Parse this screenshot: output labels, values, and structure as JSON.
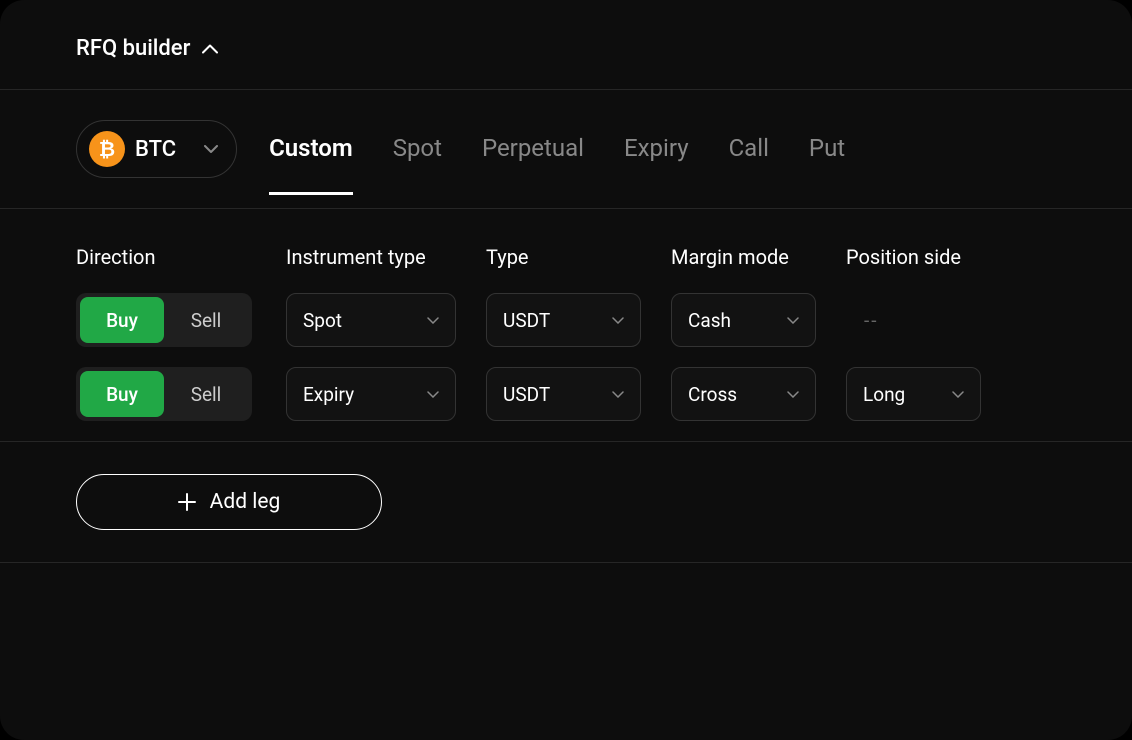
{
  "header": {
    "title": "RFQ builder"
  },
  "asset": {
    "symbol": "BTC",
    "icon_glyph": "₿"
  },
  "tabs": [
    {
      "label": "Custom",
      "active": true
    },
    {
      "label": "Spot",
      "active": false
    },
    {
      "label": "Perpetual",
      "active": false
    },
    {
      "label": "Expiry",
      "active": false
    },
    {
      "label": "Call",
      "active": false
    },
    {
      "label": "Put",
      "active": false
    }
  ],
  "columns": {
    "direction": "Direction",
    "instrument_type": "Instrument type",
    "type": "Type",
    "margin_mode": "Margin mode",
    "position_side": "Position side"
  },
  "direction_labels": {
    "buy": "Buy",
    "sell": "Sell"
  },
  "legs": [
    {
      "direction": "Buy",
      "instrument_type": "Spot",
      "type": "USDT",
      "margin_mode": "Cash",
      "position_side": "--"
    },
    {
      "direction": "Buy",
      "instrument_type": "Expiry",
      "type": "USDT",
      "margin_mode": "Cross",
      "position_side": "Long"
    }
  ],
  "add_leg_label": "Add leg"
}
